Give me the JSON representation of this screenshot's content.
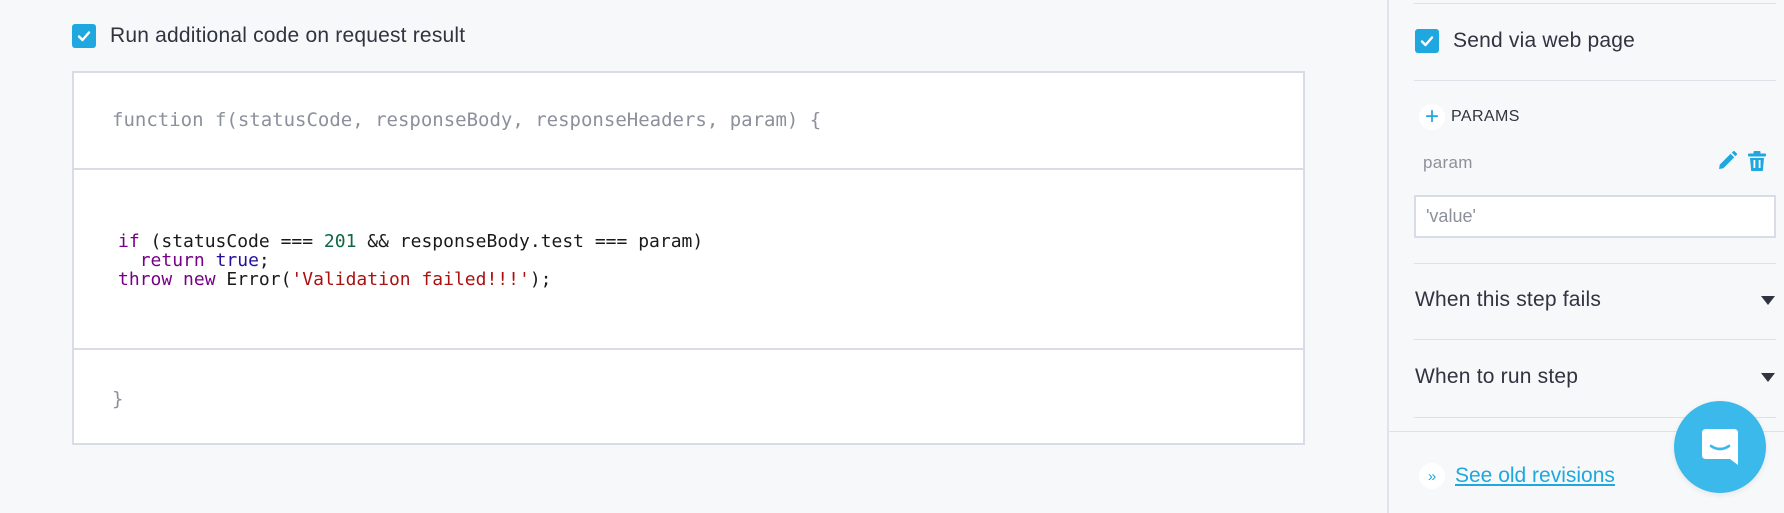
{
  "code_section": {
    "checkbox_checked": true,
    "label": "Run additional code on request result",
    "header": "function f(statusCode, responseBody, responseHeaders, param) {",
    "body": {
      "line1": {
        "kw": "if",
        "pre": " (statusCode === ",
        "num": "201",
        "post": " && responseBody.test === param)"
      },
      "line2": {
        "indent": "  ",
        "kw": "return",
        "sp": " ",
        "atom": "true",
        "end": ";"
      },
      "line3": {
        "kw1": "throw",
        "sp": " ",
        "kw2": "new",
        "pre": " Error(",
        "str": "'Validation failed!!!'",
        "end": ");"
      }
    },
    "footer": "}"
  },
  "sidebar": {
    "send_checkbox_checked": true,
    "send_label": "Send via web page",
    "params_label": "PARAMS",
    "param": {
      "name": "param",
      "value": "'value'"
    },
    "accordions": [
      {
        "label": "When this step fails"
      },
      {
        "label": "When to run step"
      }
    ],
    "revisions_link": "See old revisions"
  },
  "colors": {
    "accent": "#1fa7df",
    "chat_button": "#3bb9ea",
    "text": "#2f3440",
    "muted": "#8c909b",
    "keyword": "#770088",
    "atom": "#221199",
    "number": "#116644",
    "string": "#aa1111"
  },
  "icons": {
    "checkbox": "check-icon",
    "add": "plus-icon",
    "edit": "pencil-icon",
    "delete": "trash-icon",
    "expand": "caret-down-icon",
    "revisions": "double-chevron-right-icon",
    "chat": "chat-bubble-icon"
  }
}
